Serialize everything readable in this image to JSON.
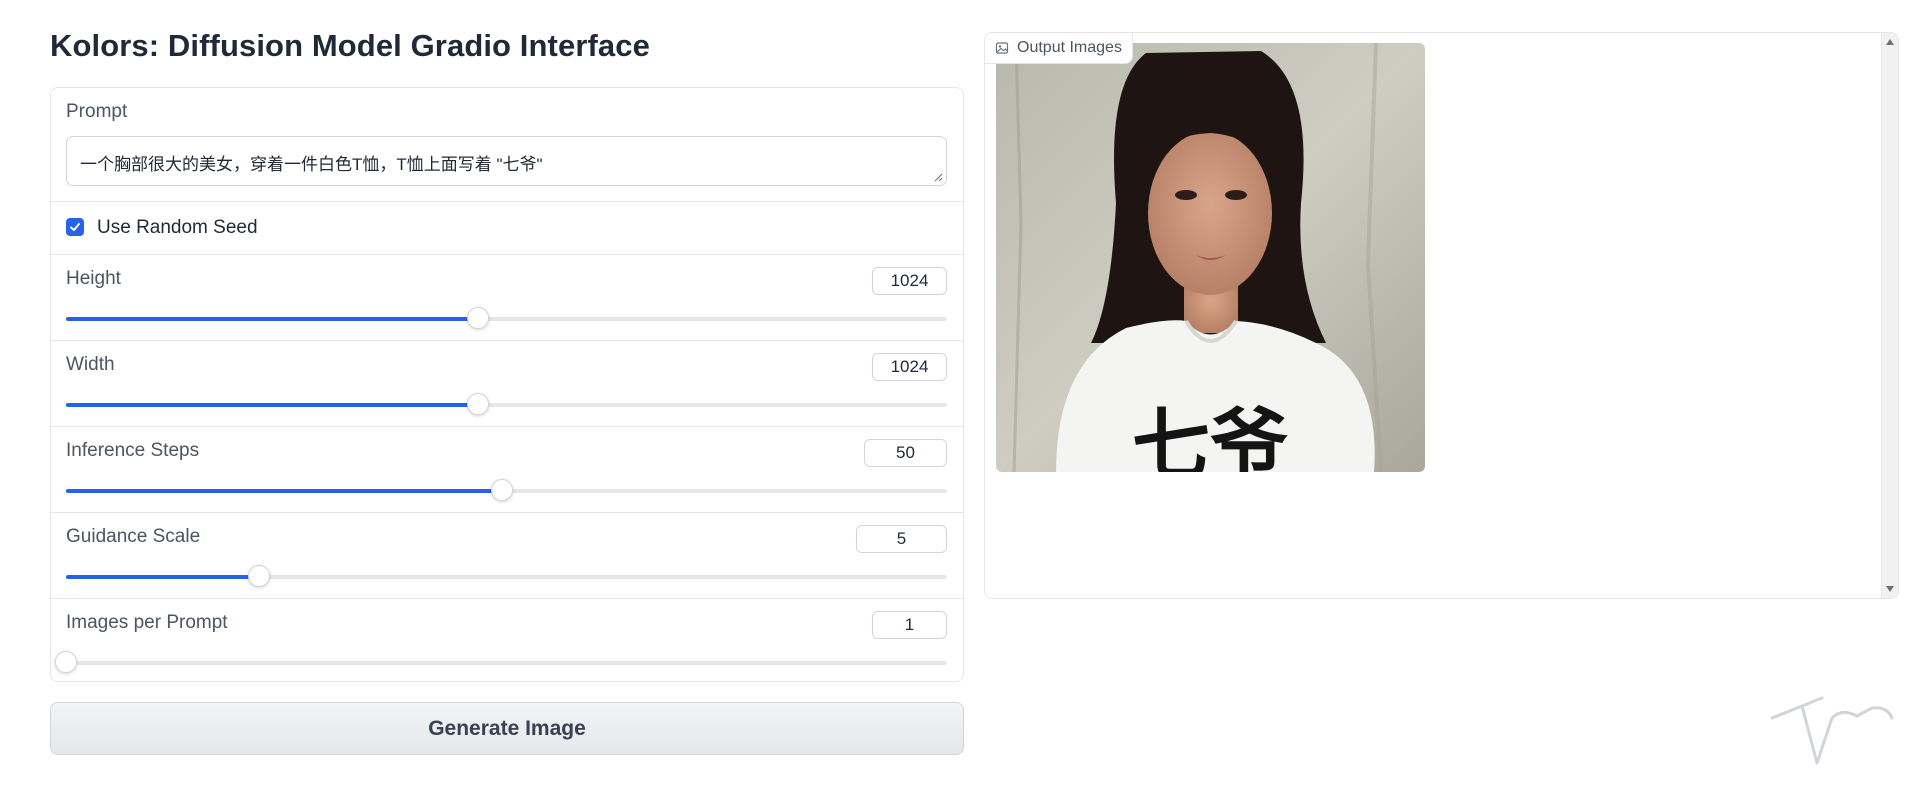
{
  "page": {
    "title": "Kolors: Diffusion Model Gradio Interface"
  },
  "prompt": {
    "label": "Prompt",
    "value": "一个胸部很大的美女，穿着一件白色T恤，T恤上面写着 \"七爷\""
  },
  "random_seed": {
    "label": "Use Random Seed",
    "checked": true
  },
  "sliders": {
    "height": {
      "label": "Height",
      "value": "1024",
      "fraction": 0.468
    },
    "width": {
      "label": "Width",
      "value": "1024",
      "fraction": 0.468
    },
    "steps": {
      "label": "Inference Steps",
      "value": "50",
      "fraction": 0.495
    },
    "guidance": {
      "label": "Guidance Scale",
      "value": "5",
      "fraction": 0.219
    },
    "images": {
      "label": "Images per Prompt",
      "value": "1",
      "fraction": 0.0
    }
  },
  "generate_button": {
    "label": "Generate Image"
  },
  "output": {
    "label": "Output Images",
    "image_text": "七爷"
  },
  "colors": {
    "accent": "#2563eb",
    "border": "#e5e7eb",
    "title": "#1f2937"
  }
}
